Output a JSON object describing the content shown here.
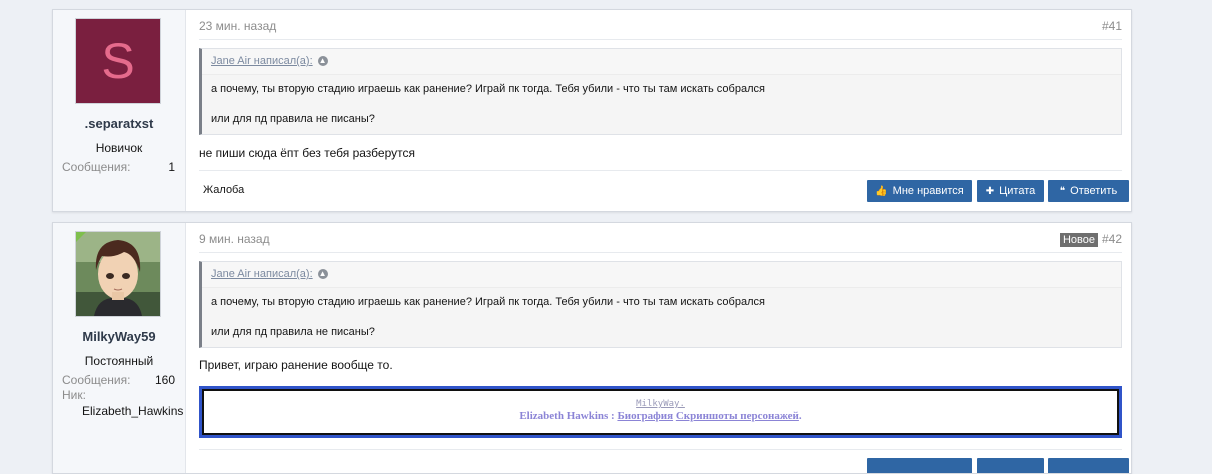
{
  "posts": [
    {
      "avatar_letter": "S",
      "username": ".separatxst",
      "user_title": "Новичок",
      "messages_label": "Сообщения:",
      "messages_count": "1",
      "time": "23 мин. назад",
      "number": "#41",
      "quote": {
        "author": "Jane Air написал(а):",
        "line1": "а почему, ты вторую стадию играешь как ранение? Играй пк тогда. Тебя убили - что ты там искать собрался",
        "line2": "или для пд правила не писаны?"
      },
      "message": "не пиши сюда ёпт без тебя разберутся",
      "report_label": "Жалоба",
      "buttons": {
        "like": "Мне нравится",
        "quote": "Цитата",
        "reply": "Ответить"
      }
    },
    {
      "username": "MilkyWay59",
      "user_title": "Постоянный",
      "messages_label": "Сообщения:",
      "messages_count": "160",
      "nick_label": "Ник:",
      "nick_value": "Elizabeth_Hawkins",
      "time": "9 мин. назад",
      "new_badge": "Новое",
      "number": "#42",
      "quote": {
        "author": "Jane Air написал(а):",
        "line1": "а почему, ты вторую стадию играешь как ранение? Играй пк тогда. Тебя убили - что ты там искать собрался",
        "line2": "или для пд правила не писаны?"
      },
      "message": "Привет, играю ранение вообще то.",
      "signature": {
        "name": "MilkyWay.",
        "character": "Elizabeth Hawkins",
        "separator": " : ",
        "bio_link": "Биография",
        "screens_link": "Скриншоты персонажей",
        "end": "."
      }
    }
  ],
  "colors": {
    "page_bg": "#edf0f5",
    "button_bg": "#2f66a4",
    "avatar_bg": "#7a1f3f",
    "signature_border": "#3054c9"
  },
  "icons": {
    "like": "thumbs-up-icon",
    "quote": "plus-icon",
    "reply": "quote-marks-icon",
    "expand": "circle-arrow-icon"
  }
}
